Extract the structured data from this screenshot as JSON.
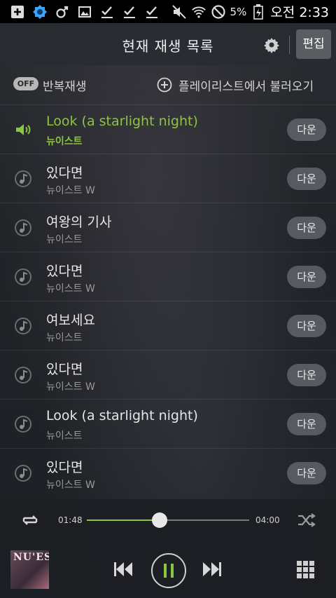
{
  "status_bar": {
    "icons": [
      "add-box-icon",
      "brightness-icon",
      "gender-icon",
      "image-icon",
      "check-icon",
      "check-icon",
      "check-icon"
    ],
    "battery": "5%",
    "time": "오전 2:33"
  },
  "header": {
    "title": "현재 재생 목록",
    "edit_label": "편집"
  },
  "options": {
    "repeat_badge": "OFF",
    "repeat_label": "반복재생",
    "load_label": "플레이리스트에서 불러오기"
  },
  "playlist": [
    {
      "title": "Look (a starlight night)",
      "artist": "뉴이스트",
      "button": "다운",
      "active": true
    },
    {
      "title": "있다면",
      "artist": "뉴이스트 W",
      "button": "다운",
      "active": false
    },
    {
      "title": "여왕의 기사",
      "artist": "뉴이스트",
      "button": "다운",
      "active": false
    },
    {
      "title": "있다면",
      "artist": "뉴이스트 W",
      "button": "다운",
      "active": false
    },
    {
      "title": "여보세요",
      "artist": "뉴이스트",
      "button": "다운",
      "active": false
    },
    {
      "title": "있다면",
      "artist": "뉴이스트 W",
      "button": "다운",
      "active": false
    },
    {
      "title": "Look (a starlight night)",
      "artist": "뉴이스트",
      "button": "다운",
      "active": false
    },
    {
      "title": "있다면",
      "artist": "뉴이스트 W",
      "button": "다운",
      "active": false
    }
  ],
  "player": {
    "current_time": "01:48",
    "total_time": "04:00",
    "progress": 0.45,
    "album_text": "NU'EST"
  },
  "colors": {
    "accent": "#8cc63f"
  }
}
